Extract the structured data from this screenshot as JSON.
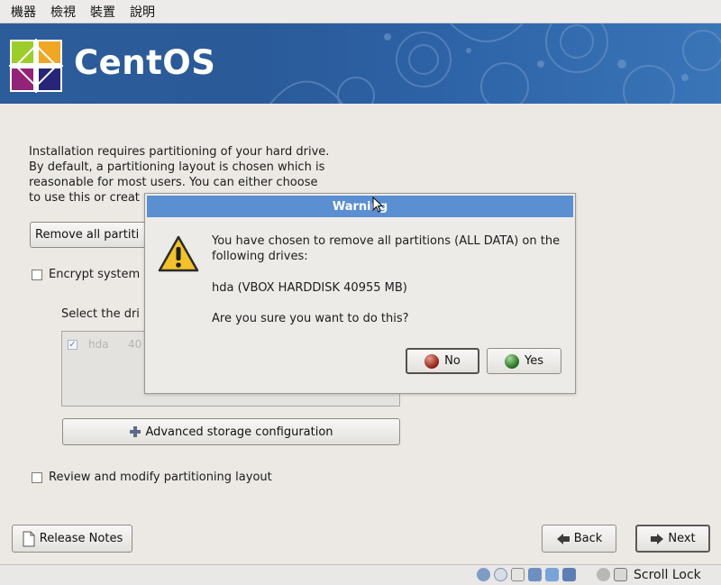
{
  "menubar": {
    "items": [
      "機器",
      "檢視",
      "裝置",
      "說明"
    ]
  },
  "banner": {
    "logo_text": "CentOS"
  },
  "installer": {
    "intro_lines": [
      "Installation requires partitioning of your hard drive.",
      "By default, a partitioning layout is chosen which is",
      "reasonable for most users.  You can either choose",
      "to use this or creat"
    ],
    "layout_combo_value": "Remove all partiti",
    "encrypt_label": "Encrypt system",
    "select_drives_label": "Select the dri",
    "drives": [
      {
        "checked": true,
        "name": "hda",
        "size": "40"
      }
    ],
    "advanced_button": "Advanced storage configuration",
    "review_label": "Review and modify partitioning layout"
  },
  "footer": {
    "release_notes": "Release Notes",
    "back": "Back",
    "next": "Next"
  },
  "statusbar": {
    "scroll_lock": "Scroll Lock"
  },
  "dialog": {
    "title": "Warning",
    "message": "You have chosen to remove all partitions (ALL DATA) on the following drives:",
    "drive": "hda (VBOX HARDDISK 40955 MB)",
    "confirm": "Are you sure you want to do this?",
    "no_label": "No",
    "yes_label": "Yes"
  },
  "colors": {
    "banner": "#2c5c9a",
    "dialog_title": "#5a8fd1",
    "window_bg": "#ece9e4"
  }
}
